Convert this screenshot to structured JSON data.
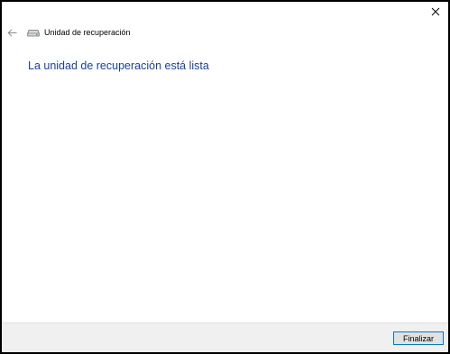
{
  "window": {
    "title": "Unidad de recuperación",
    "close_icon": "close-icon",
    "back_icon": "back-arrow-icon",
    "app_icon": "drive-icon"
  },
  "main": {
    "heading": "La unidad de recuperación está lista"
  },
  "footer": {
    "finish_label": "Finalizar"
  },
  "colors": {
    "heading": "#1a3f9e",
    "footer_bg": "#f0f0f0",
    "button_border": "#0078d7"
  }
}
